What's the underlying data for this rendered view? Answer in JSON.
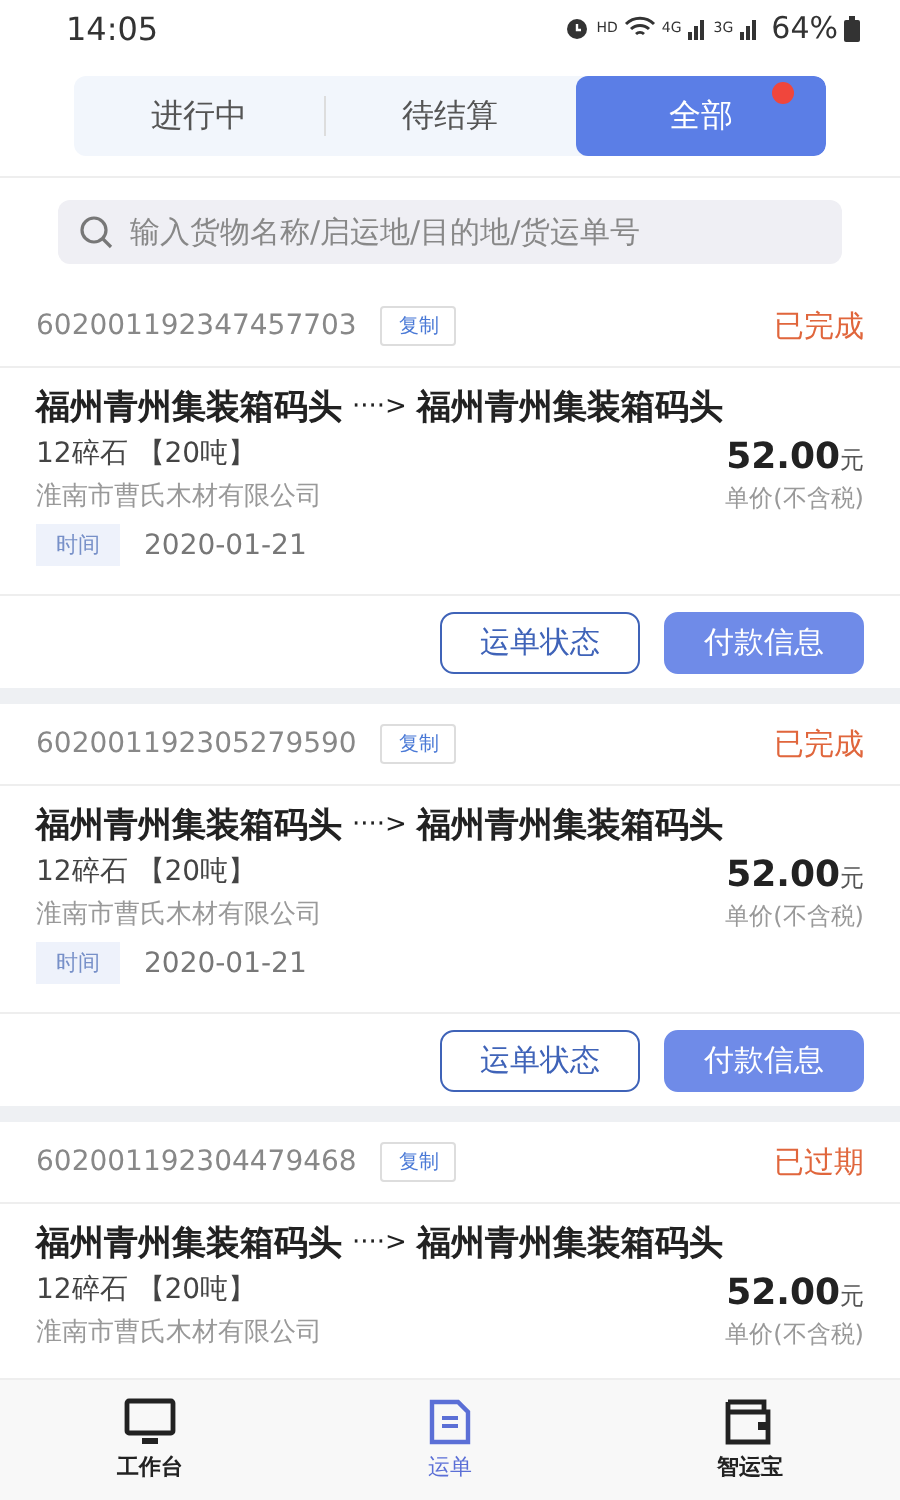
{
  "status_bar": {
    "time": "14:05",
    "hd": "HD",
    "networks": [
      "4G",
      "3G"
    ],
    "battery": "64%"
  },
  "tabs": [
    {
      "label": "进行中",
      "selected": false,
      "dot": false
    },
    {
      "label": "待结算",
      "selected": false,
      "dot": false
    },
    {
      "label": "全部",
      "selected": true,
      "dot": true
    }
  ],
  "search": {
    "placeholder": "输入货物名称/启运地/目的地/货运单号"
  },
  "orders": [
    {
      "number": "602001192347457703",
      "copy": "复制",
      "status": "已完成",
      "from": "福州青州集装箱码头",
      "arrow": "····>",
      "to": "福州青州集装箱码头",
      "cargo": "12碎石 【20吨】",
      "company": "淮南市曹氏木材有限公司",
      "price": "52.00",
      "unit": "元",
      "price_note": "单价(不含税)",
      "time_label": "时间",
      "time": "2020-01-21",
      "actions": [
        {
          "label": "运单状态",
          "kind": "outline"
        },
        {
          "label": "付款信息",
          "kind": "primary"
        }
      ]
    },
    {
      "number": "602001192305279590",
      "copy": "复制",
      "status": "已完成",
      "from": "福州青州集装箱码头",
      "arrow": "····>",
      "to": "福州青州集装箱码头",
      "cargo": "12碎石 【20吨】",
      "company": "淮南市曹氏木材有限公司",
      "price": "52.00",
      "unit": "元",
      "price_note": "单价(不含税)",
      "time_label": "时间",
      "time": "2020-01-21",
      "actions": [
        {
          "label": "运单状态",
          "kind": "outline"
        },
        {
          "label": "付款信息",
          "kind": "primary"
        }
      ]
    },
    {
      "number": "602001192304479468",
      "copy": "复制",
      "status": "已过期",
      "from": "福州青州集装箱码头",
      "arrow": "····>",
      "to": "福州青州集装箱码头",
      "cargo": "12碎石 【20吨】",
      "company": "淮南市曹氏木材有限公司",
      "price": "52.00",
      "unit": "元",
      "price_note": "单价(不含税)"
    }
  ],
  "nav": [
    {
      "label": "工作台",
      "kind": "monitor",
      "selected": false
    },
    {
      "label": "运单",
      "kind": "document",
      "selected": true
    },
    {
      "label": "智运宝",
      "kind": "wallet",
      "selected": false
    }
  ]
}
